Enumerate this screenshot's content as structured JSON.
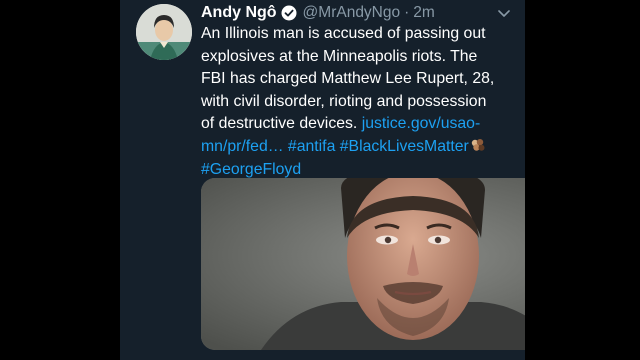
{
  "tweet": {
    "author_name": "Andy Ngô",
    "handle": "@MrAndyNgo",
    "separator": "·",
    "time": "2m",
    "body_lines": [
      "An Illinois man is accused of passing out",
      "explosives at the Minneapolis riots. The",
      "FBI has charged Matthew Lee Rupert, 28,",
      "with civil disorder, rioting and possession",
      "of destructive devices."
    ],
    "link_text_part1": "justice.gov/usao-",
    "link_text_part2": "mn/pr/fed…",
    "hashtags": [
      "#antifa",
      "#BlackLivesMatter",
      "#GeorgeFloyd"
    ],
    "icons": {
      "verified": "verified-badge-icon",
      "menu": "chevron-down-icon",
      "emoji": "raised-fists-emoji-icon"
    },
    "colors": {
      "background": "#15202b",
      "link": "#1da1f2",
      "secondary_text": "#8899a6",
      "primary_text": "#ffffff"
    }
  }
}
